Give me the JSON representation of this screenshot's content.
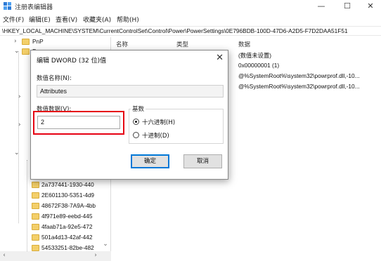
{
  "window": {
    "title": "注册表编辑器",
    "minimize_glyph": "—",
    "maximize_glyph": "☐",
    "close_glyph": "✕"
  },
  "menu": [
    "文件(F)",
    "编辑(E)",
    "查看(V)",
    "收藏夹(A)",
    "帮助(H)"
  ],
  "address": "\\HKEY_LOCAL_MACHINE\\SYSTEM\\CurrentControlSet\\Control\\Power\\PowerSettings\\0E796BDB-100D-47D6-A2D5-F7D2DAA51F51",
  "tree": {
    "top_items": [
      "PnP",
      "Po"
    ],
    "guid_items": [
      "2a737441-1930-440",
      "2E601130-5351-4d9",
      "48672F38-7A9A-4bb",
      "4f971e89-eebd-445",
      "4faab71a-92e5-472",
      "501a4d13-42af-442",
      "54533251-82be-482"
    ]
  },
  "list": {
    "headers": {
      "name": "名称",
      "type": "类型",
      "data": "数据"
    },
    "rows": [
      {
        "data": "(数值未设置)"
      },
      {
        "data": "0x00000001 (1)"
      },
      {
        "data": "@%SystemRoot%\\system32\\powrprof.dll,-10..."
      },
      {
        "data": "@%SystemRoot%\\system32\\powrprof.dll,-10..."
      }
    ]
  },
  "dialog": {
    "title": "编辑 DWORD (32 位)值",
    "close_glyph": "✕",
    "name_label": "数值名称(N):",
    "name_value": "Attributes",
    "data_label": "数值数据(V):",
    "data_value": "2",
    "base_label": "基数",
    "base_options": [
      {
        "label": "十六进制(H)",
        "checked": true
      },
      {
        "label": "十进制(D)",
        "checked": false
      }
    ],
    "ok_label": "确定",
    "cancel_label": "取消"
  },
  "colors": {
    "highlight": "#e60012",
    "folder": "#f3cf6a",
    "default_button_border": "#0078d7"
  }
}
